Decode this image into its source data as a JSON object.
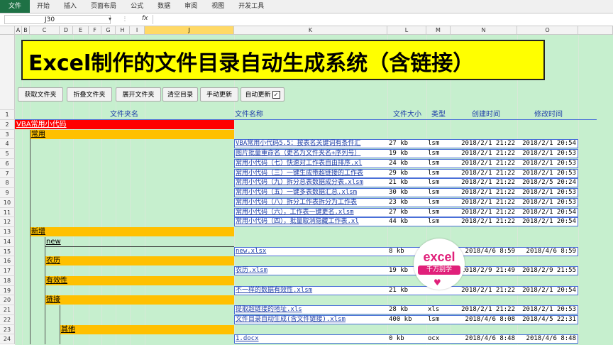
{
  "ribbon": {
    "tabs": [
      "文件",
      "开始",
      "插入",
      "页面布局",
      "公式",
      "数据",
      "审阅",
      "视图",
      "开发工具"
    ]
  },
  "formula_bar": {
    "name_box": "J30",
    "fx": "fx",
    "value": ""
  },
  "columns": [
    "A",
    "B",
    "C",
    "D",
    "E",
    "F",
    "G",
    "H",
    "I",
    "J",
    "K",
    "L",
    "M",
    "N",
    "O"
  ],
  "selected_column": "J",
  "rows": [
    "1",
    "2",
    "3",
    "4",
    "5",
    "6",
    "7",
    "8",
    "9",
    "10",
    "11",
    "12",
    "13",
    "14",
    "15",
    "16",
    "17",
    "18",
    "19",
    "20",
    "21",
    "22",
    "23",
    "24"
  ],
  "banner": {
    "title": "Excel制作的文件目录自动生成系统（含链接）"
  },
  "buttons": {
    "get_folder": "获取文件夹",
    "collapse_folder": "折叠文件夹",
    "expand_folder": "展开文件夹",
    "clear_dir": "清空目录",
    "manual_update": "手动更新",
    "auto_update": "自动更新",
    "auto_update_checked": "✓"
  },
  "headers": {
    "folder_name": "文件夹名",
    "file_name": "文件名称",
    "file_size": "文件大小",
    "type": "类型",
    "created": "创建时间",
    "modified": "修改时间"
  },
  "folders": [
    {
      "row": 2,
      "name": "VBA常用小代码",
      "level": 0,
      "color": "red"
    },
    {
      "row": 3,
      "name": "常用",
      "level": 1,
      "color": "orange"
    },
    {
      "row": 13,
      "name": "新增",
      "level": 1,
      "color": "orange"
    },
    {
      "row": 14,
      "name": "new",
      "level": 2,
      "color": "none"
    },
    {
      "row": 16,
      "name": "农历",
      "level": 2,
      "color": "orange"
    },
    {
      "row": 18,
      "name": "有效性",
      "level": 2,
      "color": "orange"
    },
    {
      "row": 20,
      "name": "链接",
      "level": 2,
      "color": "orange"
    },
    {
      "row": 23,
      "name": "其他",
      "level": 3,
      "color": "orange"
    }
  ],
  "files": [
    {
      "row": 4,
      "name": "VBA常用小代码5.5：按表名关键词有条件汇",
      "size": "27 kb",
      "type": "lsm",
      "created": "2018/2/1 21:22",
      "modified": "2018/2/1 20:54"
    },
    {
      "row": 5,
      "name": "图片批量重命名（更名为文件夹名+序列号）",
      "size": "19 kb",
      "type": "lsm",
      "created": "2018/2/1 21:22",
      "modified": "2018/2/1 20:53"
    },
    {
      "row": 6,
      "name": "常用小代码（七）快速对工作表自由排序.xl",
      "size": "24 kb",
      "type": "lsm",
      "created": "2018/2/1 21:22",
      "modified": "2018/2/1 20:53"
    },
    {
      "row": 7,
      "name": "常用小代码（三）一键生成带超链接的工作表",
      "size": "29 kb",
      "type": "lsm",
      "created": "2018/2/1 21:22",
      "modified": "2018/2/1 20:53"
    },
    {
      "row": 8,
      "name": "常用小代码（九）拆分总表数据成分表.xlsm",
      "size": "21 kb",
      "type": "lsm",
      "created": "2018/2/1 21:22",
      "modified": "2018/2/5 20:24"
    },
    {
      "row": 9,
      "name": "常用小代码（五）一键多表数据汇总.xlsm",
      "size": "30 kb",
      "type": "lsm",
      "created": "2018/2/1 21:22",
      "modified": "2018/2/1 20:53"
    },
    {
      "row": 10,
      "name": "常用小代码（八）拆分工作表拆分为工作表",
      "size": "23 kb",
      "type": "lsm",
      "created": "2018/2/1 21:22",
      "modified": "2018/2/1 20:53"
    },
    {
      "row": 11,
      "name": "常用小代码（六），工作表一键更名.xlsm",
      "size": "27 kb",
      "type": "lsm",
      "created": "2018/2/1 21:22",
      "modified": "2018/2/1 20:54"
    },
    {
      "row": 12,
      "name": "常用小代码（四），批量取消隐藏工作表.xl",
      "size": "44 kb",
      "type": "lsm",
      "created": "2018/2/1 21:22",
      "modified": "2018/2/1 20:54"
    },
    {
      "row": 15,
      "name": "new.xlsx",
      "size": "8 kb",
      "type": "",
      "created": "2018/4/6 8:59",
      "modified": "2018/4/6 8:59"
    },
    {
      "row": 17,
      "name": "农历.xlsm",
      "size": "19 kb",
      "type": "",
      "created": "2018/2/9 21:49",
      "modified": "2018/2/9 21:55"
    },
    {
      "row": 19,
      "name": "不一样的数据有效性.xlsm",
      "size": "21 kb",
      "type": "",
      "created": "2018/2/1 21:22",
      "modified": "2018/2/1 20:54"
    },
    {
      "row": 21,
      "name": "提取超链接的地址.xls",
      "size": "28 kb",
      "type": "xls",
      "created": "2018/2/1 21:22",
      "modified": "2018/2/1 20:53"
    },
    {
      "row": 22,
      "name": "文件目录自动生成(含文件链接).xlsm",
      "size": "400 kb",
      "type": "lsm",
      "created": "2018/4/6 8:08",
      "modified": "2018/4/5 22:31"
    },
    {
      "row": 24,
      "name": "1.docx",
      "size": "0 kb",
      "type": "ocx",
      "created": "2018/4/6 8:48",
      "modified": "2018/4/6 8:48"
    }
  ],
  "logo": {
    "word": "excel",
    "subtitle": "千万别学",
    "heart": "♥"
  },
  "colors": {
    "sheet_bg": "#c6efce",
    "banner": "#ffff00",
    "red_bar": "#ff0000",
    "orange_bar": "#ffc000",
    "link": "#1f3fa8",
    "logo": "#e0207a"
  }
}
